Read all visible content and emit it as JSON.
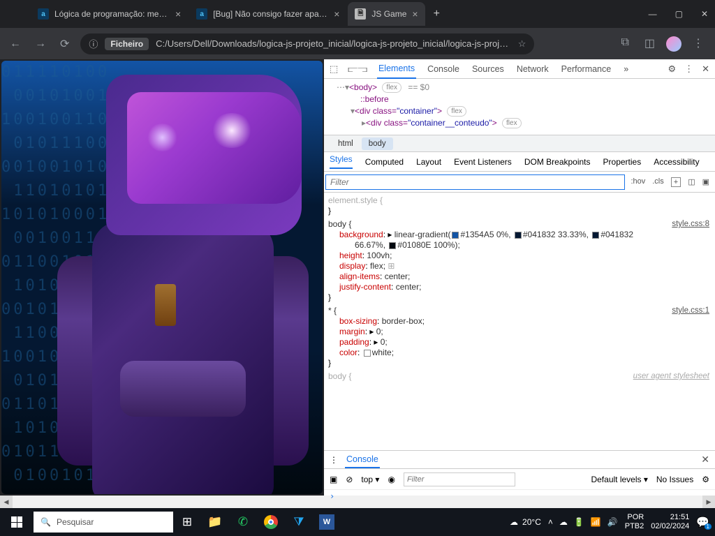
{
  "tabs": [
    {
      "title": "Lógica de programação: mergu..."
    },
    {
      "title": "[Bug] Não consigo fazer aparec..."
    },
    {
      "title": "JS Game"
    }
  ],
  "url_badge": "Ficheiro",
  "url": "C:/Users/Dell/Downloads/logica-js-projeto_inicial/logica-js-projeto_inicial/logica-js-projeto_inici...",
  "dt_tabs": [
    "Elements",
    "Console",
    "Sources",
    "Network",
    "Performance"
  ],
  "dom": {
    "body": "<body>",
    "eq": " == $0",
    "before": "::before",
    "div1_open": "<div class=",
    "div1_cls": "\"container\"",
    "div1_close": ">",
    "div2_open": "<div class=",
    "div2_cls": "\"container__conteudo\"",
    "div2_close": ">",
    "flex": "flex"
  },
  "crumbs": [
    "html",
    "body"
  ],
  "style_tabs": [
    "Styles",
    "Computed",
    "Layout",
    "Event Listeners",
    "DOM Breakpoints",
    "Properties",
    "Accessibility"
  ],
  "filter_ph": "Filter",
  "filter_btns": [
    ":hov",
    ".cls",
    "+"
  ],
  "rules": {
    "el_style": "element.style {",
    "body_sel": "body {",
    "body_link": "style.css:8",
    "bg_prop": "background",
    "bg_val1": "linear-gradient(",
    "bg_c1": "#1354A5 0%,",
    "bg_c2": "#041832 33.33%,",
    "bg_c3": "#041832",
    "bg_c3b": "66.67%,",
    "bg_c4": "#01080E 100%);",
    "height_p": "height",
    "height_v": "100vh;",
    "display_p": "display",
    "display_v": "flex;",
    "align_p": "align-items",
    "align_v": "center;",
    "justify_p": "justify-content",
    "justify_v": "center;",
    "star_sel": "* {",
    "star_link": "style.css:1",
    "bs_p": "box-sizing",
    "bs_v": "border-box;",
    "mg_p": "margin",
    "mg_v": "0;",
    "pd_p": "padding",
    "pd_v": "0;",
    "cl_p": "color",
    "cl_v": "white;",
    "ua": "user agent stylesheet",
    "body2": "body {"
  },
  "console_tab": "Console",
  "console": {
    "top": "top",
    "filter": "Filter",
    "levels": "Default levels",
    "issues": "No Issues"
  },
  "taskbar": {
    "search": "Pesquisar",
    "temp": "20°C",
    "lang1": "POR",
    "lang2": "PTB2",
    "time": "21:51",
    "date": "02/02/2024",
    "badge": "1"
  },
  "binary": "011110100\n 001010011\n1001001101\n 010111000\n0010010100\n 110101011\n1010100010\n 001001101\n0110010100\n 101010110\n0010101011\n 110010010\n1001010100\n 010110101\n0110101001\n 101001010\n0101101010\n 010010110"
}
